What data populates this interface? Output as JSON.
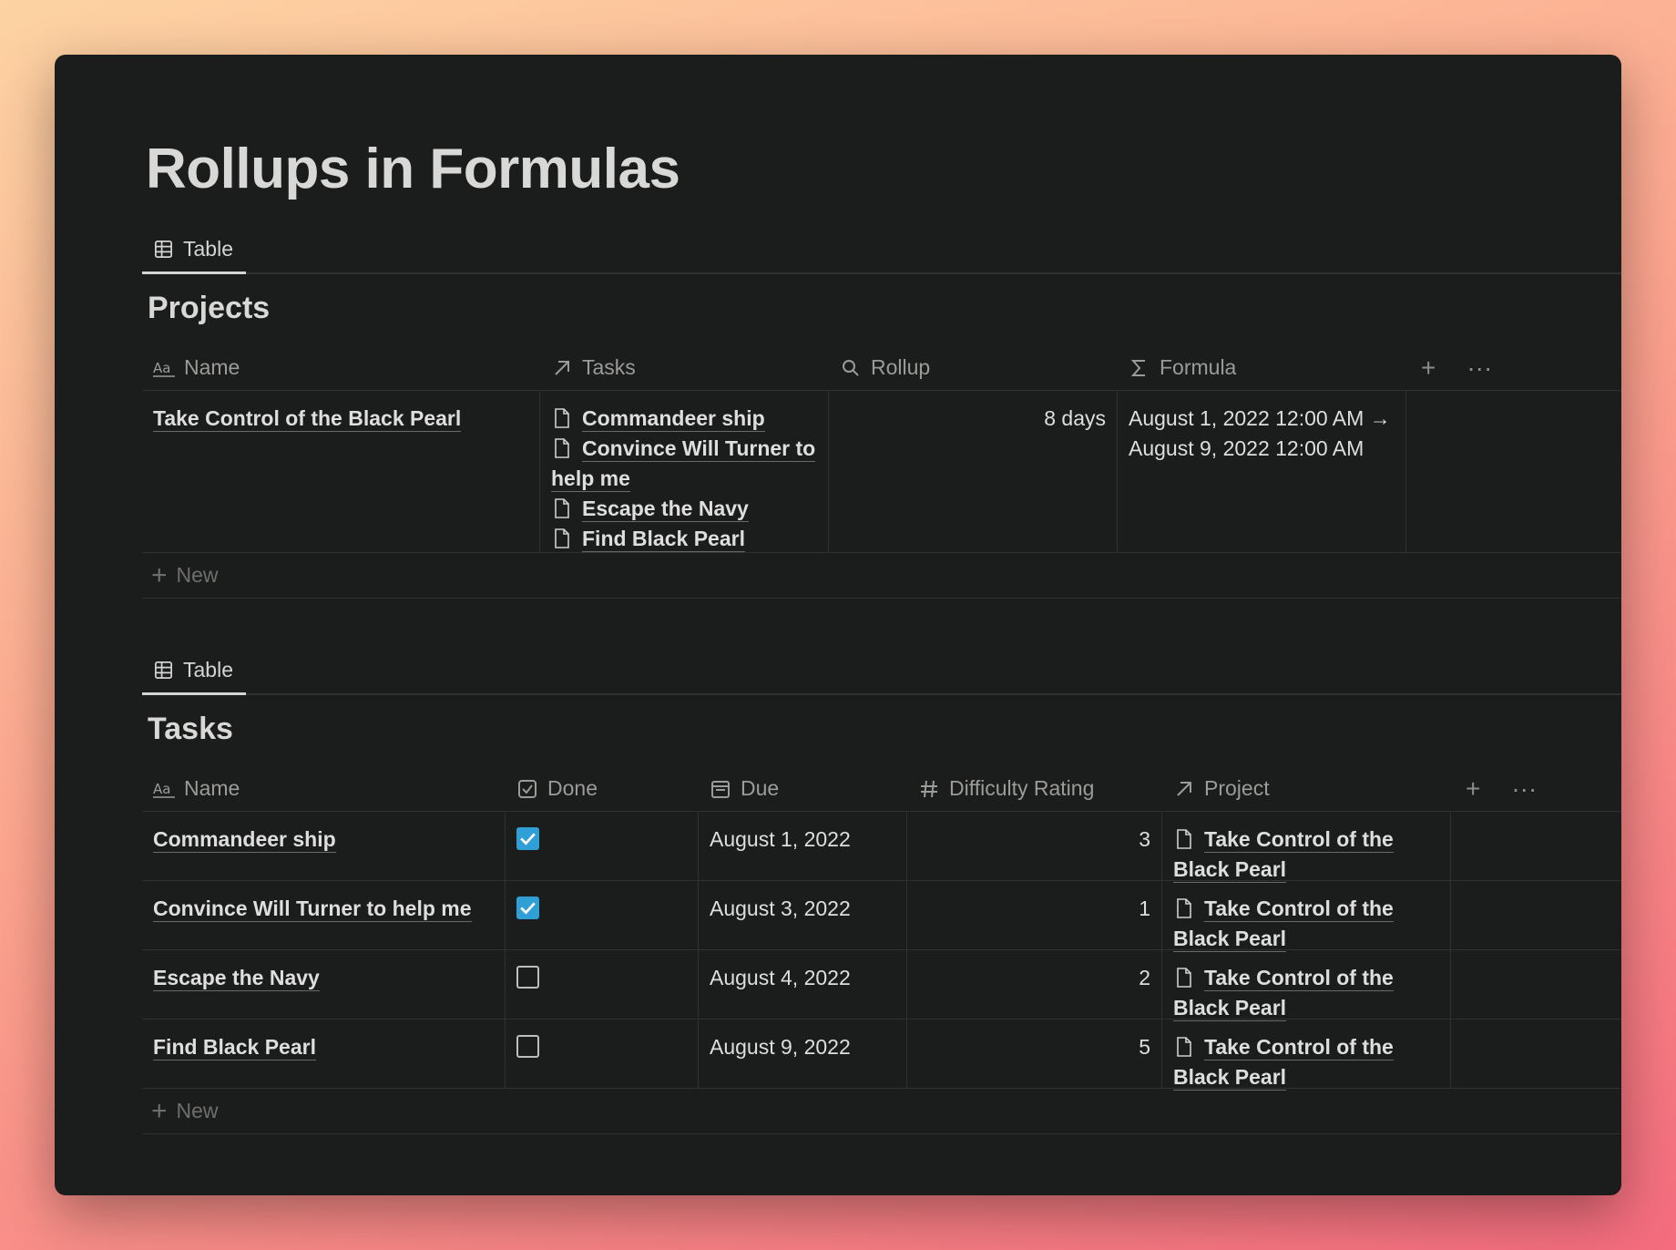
{
  "page": {
    "title": "Rollups in Formulas"
  },
  "projects": {
    "tab_label": "Table",
    "title": "Projects",
    "columns": [
      "Name",
      "Tasks",
      "Rollup",
      "Formula"
    ],
    "rows": [
      {
        "name": "Take Control of the Black Pearl",
        "tasks": [
          "Commandeer ship",
          "Convince Will Turner to help me",
          "Escape the Navy",
          "Find Black Pearl"
        ],
        "rollup": "8 days",
        "formula": "August 1, 2022 12:00 AM → August 9, 2022 12:00 AM"
      }
    ],
    "new_label": "New"
  },
  "tasks": {
    "tab_label": "Table",
    "title": "Tasks",
    "columns": [
      "Name",
      "Done",
      "Due",
      "Difficulty Rating",
      "Project"
    ],
    "rows": [
      {
        "name": "Commandeer ship",
        "done": true,
        "due": "August 1, 2022",
        "difficulty": "3",
        "project": "Take Control of the Black Pearl"
      },
      {
        "name": "Convince Will Turner to help me",
        "done": true,
        "due": "August 3, 2022",
        "difficulty": "1",
        "project": "Take Control of the Black Pearl"
      },
      {
        "name": "Escape the Navy",
        "done": false,
        "due": "August 4, 2022",
        "difficulty": "2",
        "project": "Take Control of the Black Pearl"
      },
      {
        "name": "Find Black Pearl",
        "done": false,
        "due": "August 9, 2022",
        "difficulty": "5",
        "project": "Take Control of the Black Pearl"
      }
    ],
    "new_label": "New"
  },
  "icons": {
    "add_column": "plus-icon",
    "more": "ellipsis-icon"
  },
  "colors": {
    "background": "#1b1c1c",
    "checkbox_checked": "#2f9fd6"
  }
}
